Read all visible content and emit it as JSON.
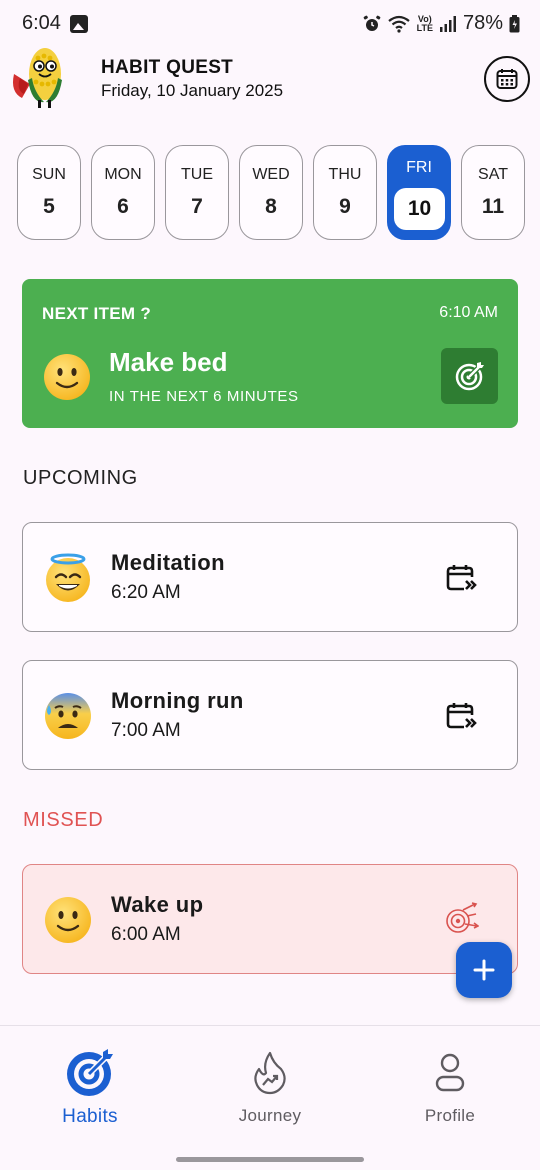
{
  "status_bar": {
    "time": "6:04",
    "battery": "78%",
    "network_badge_top": "Vo)",
    "network_badge_bottom": "LTE",
    "icons": [
      "image-icon",
      "alarm-icon",
      "wifi-icon",
      "signal-icon",
      "battery-icon"
    ]
  },
  "header": {
    "title": "HABIT QUEST",
    "date": "Friday, 10 January 2025",
    "calendar_icon": "calendar-icon",
    "mascot_icon": "corn-hero-mascot"
  },
  "days": [
    {
      "name": "SUN",
      "num": "5",
      "selected": false
    },
    {
      "name": "MON",
      "num": "6",
      "selected": false
    },
    {
      "name": "TUE",
      "num": "7",
      "selected": false
    },
    {
      "name": "WED",
      "num": "8",
      "selected": false
    },
    {
      "name": "THU",
      "num": "9",
      "selected": false
    },
    {
      "name": "FRI",
      "num": "10",
      "selected": true
    },
    {
      "name": "SAT",
      "num": "11",
      "selected": false
    }
  ],
  "next_item": {
    "label": "NEXT ITEM ?",
    "time": "6:10 AM",
    "title": "Make bed",
    "subtitle": "IN THE NEXT 6 MINUTES",
    "emoji": "slightly-smiling-face",
    "action_icon": "target-icon",
    "color": "#4caf50"
  },
  "upcoming": {
    "heading": "UPCOMING",
    "items": [
      {
        "name": "Meditation",
        "time": "6:20 AM",
        "emoji": "smiling-face-with-halo",
        "action_icon": "calendar-skip-icon"
      },
      {
        "name": "Morning run",
        "time": "7:00 AM",
        "emoji": "anxious-face-with-sweat",
        "action_icon": "calendar-skip-icon"
      }
    ]
  },
  "missed": {
    "heading": "MISSED",
    "color": "#e05353",
    "items": [
      {
        "name": "Wake up",
        "time": "6:00 AM",
        "emoji": "slightly-smiling-face",
        "action_icon": "missed-target-icon"
      }
    ]
  },
  "fab": {
    "icon": "plus-icon"
  },
  "bottom_nav": [
    {
      "label": "Habits",
      "icon": "target-icon",
      "active": true
    },
    {
      "label": "Journey",
      "icon": "flame-trend-icon",
      "active": false
    },
    {
      "label": "Profile",
      "icon": "person-icon",
      "active": false
    }
  ],
  "colors": {
    "primary": "#1b5fd1",
    "background": "#fdf7fd",
    "success": "#4caf50",
    "danger": "#e05353"
  }
}
